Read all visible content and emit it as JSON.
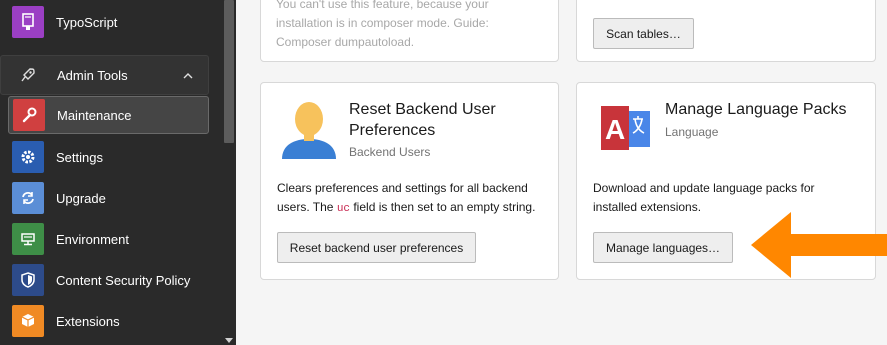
{
  "sidebar": {
    "typoscript": {
      "label": "TypoScript",
      "icon": "typoscript-icon",
      "color": "#9b3fc4"
    },
    "admin_tools": {
      "label": "Admin Tools",
      "icon": "rocket-icon"
    },
    "items": [
      {
        "label": "Maintenance",
        "icon": "wrench-icon",
        "color": "#d04040"
      },
      {
        "label": "Settings",
        "icon": "gear-icon",
        "color": "#2a5db0"
      },
      {
        "label": "Upgrade",
        "icon": "refresh-icon",
        "color": "#5b8ed6"
      },
      {
        "label": "Environment",
        "icon": "server-icon",
        "color": "#3e8e47"
      },
      {
        "label": "Content Security Policy",
        "icon": "shield-icon",
        "color": "#2d4b8a"
      },
      {
        "label": "Extensions",
        "icon": "box-icon",
        "color": "#f08a24"
      }
    ]
  },
  "cards": {
    "composer": {
      "text_line1": "You can't use this feature, because your",
      "text_line2": "installation is in composer mode. Guide:",
      "text_line3": "Composer dumpautoload."
    },
    "scan": {
      "button": "Scan tables…"
    },
    "reset": {
      "title_line1": "Reset Backend User",
      "title_line2": "Preferences",
      "subtitle": "Backend Users",
      "text_line1": "Clears preferences and settings for all backend",
      "text_pre": "users. The ",
      "text_code": "uc",
      "text_post": " field is then set to an empty string.",
      "button": "Reset backend user preferences"
    },
    "language": {
      "title": "Manage Language Packs",
      "subtitle": "Language",
      "text_line1": "Download and update language packs for",
      "text_line2": "installed extensions.",
      "button": "Manage languages…"
    }
  },
  "colors": {
    "arrow": "#ff8700",
    "accent_red": "#c8343a",
    "accent_blue": "#4a86e8"
  }
}
